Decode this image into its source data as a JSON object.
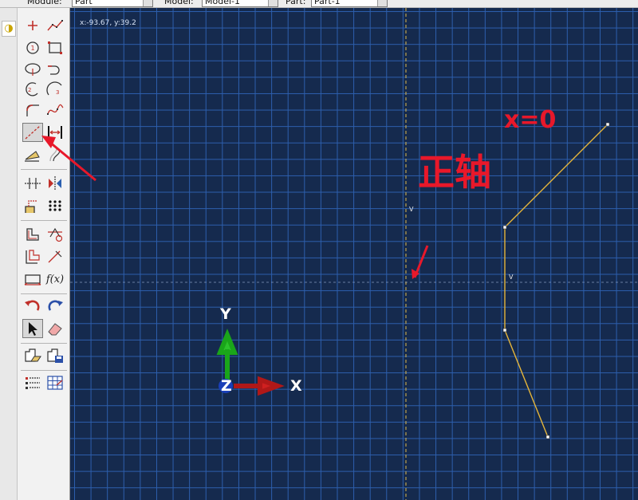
{
  "context_bar": {
    "module_label": "Module:",
    "module_value": "Part",
    "model_label": "Model:",
    "model_value": "Model-1",
    "part_label": "Part:",
    "part_value": "Part-1"
  },
  "viewport": {
    "cursor_readout": "x:-93.67, y:39.2",
    "triad": {
      "x_label": "X",
      "y_label": "Y",
      "z_label": "Z"
    },
    "vertical_constraint_marks": [
      "V",
      "V"
    ],
    "annotation_text": "正轴",
    "annotation_formula": "x=0",
    "colors": {
      "background": "#152a4e",
      "grid": "#2d5fae",
      "sketch_line": "#e5b53a",
      "construction_line": "#e0b84a",
      "annotation": "#e8182a"
    }
  },
  "toolbox": {
    "tools": [
      "create-isolated-point-icon",
      "create-lines-connected-icon",
      "create-circle-icon",
      "create-rectangle-icon",
      "create-ellipse-icon",
      "create-arc-tangent-icon",
      "create-arc-center-icon",
      "create-arc-three-points-icon",
      "create-fillet-icon",
      "create-spline-icon",
      "create-construction-line-icon",
      "add-dimension-icon",
      "add-constraint-icon",
      "edit-dimension-icon",
      "split-icon",
      "mirror-icon",
      "offset-icon",
      "pattern-icon",
      "project-edges-icon",
      "add-reference-icon",
      "copy-icon",
      "trim-icon",
      "transform-icon",
      "parameter-icon",
      "undo-icon",
      "redo-icon",
      "select-icon",
      "erase-icon",
      "open-sketch-icon",
      "save-sketch-icon",
      "sketch-options-icon",
      "grid-options-icon"
    ],
    "parameter_label": "f(x)"
  }
}
